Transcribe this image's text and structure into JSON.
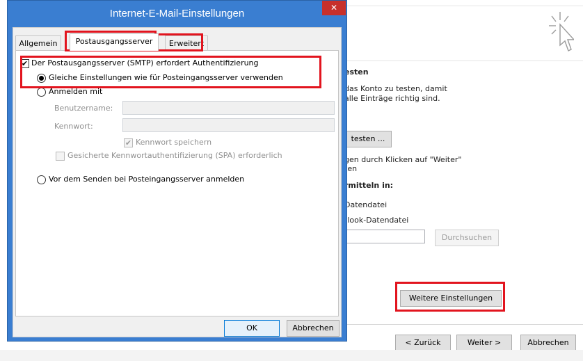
{
  "dialog": {
    "title": "Internet-E-Mail-Einstellungen",
    "close_glyph": "✕",
    "tabs": [
      {
        "label": "Allgemein"
      },
      {
        "label": "Postausgangsserver"
      },
      {
        "label": "Erweitert"
      }
    ],
    "smtp_auth": {
      "label": "Der Postausgangsserver (SMTP) erfordert Authentifizierung",
      "checked": true
    },
    "same_settings": {
      "label": "Gleiche Einstellungen wie für Posteingangsserver verwenden",
      "selected": true
    },
    "login_with": {
      "label": "Anmelden mit",
      "selected": false
    },
    "username": {
      "label": "Benutzername:",
      "value": ""
    },
    "password": {
      "label": "Kennwort:",
      "value": ""
    },
    "remember_password": {
      "label": "Kennwort speichern",
      "checked": true
    },
    "spa": {
      "label": "Gesicherte Kennwortauthentifizierung (SPA) erforderlich",
      "checked": false
    },
    "login_before_send": {
      "label": "Vor dem Senden bei Posteingangsserver anmelden",
      "selected": false
    },
    "ok_label": "OK",
    "cancel_label": "Abbrechen"
  },
  "background": {
    "section_title": "esten",
    "desc_line1": "das Konto zu testen, damit",
    "desc_line2": "alle Einträge richtig sind.",
    "test_button": "testen ...",
    "next_line1": "gen durch Klicken auf \"Weiter\"",
    "next_line2": "ten",
    "deliver_label": "rmitteln in:",
    "option1": "Datendatei",
    "option2": "tlook-Datendatei",
    "path_value": "",
    "browse_button": "Durchsuchen",
    "more_settings_button": "Weitere Einstellungen",
    "back_button": "< Zurück",
    "next_button": "Weiter >",
    "cancel_button": "Abbrechen"
  },
  "colors": {
    "title_bar": "#3a7ed1",
    "highlight": "#e2141e",
    "close_button": "#c7302b"
  }
}
